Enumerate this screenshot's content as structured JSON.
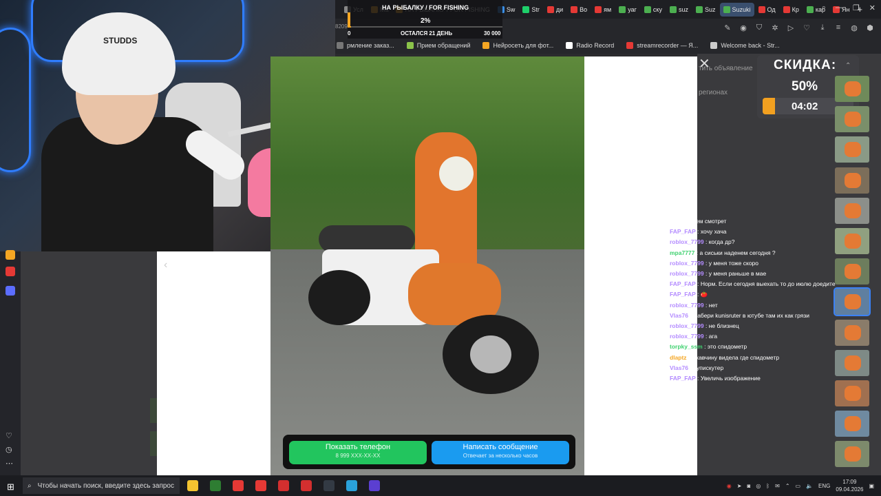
{
  "browser": {
    "tabs": [
      {
        "label": "Усл",
        "color": "#888888"
      },
      {
        "label": "Ма",
        "color": "#f5a623"
      },
      {
        "label": "НА РЫБАЛКУ / FOR FISHING",
        "color": "#f5a623"
      },
      {
        "label": "Sw",
        "color": "#3a8ee6"
      },
      {
        "label": "Str",
        "color": "#1ecf6a"
      },
      {
        "label": "ди",
        "color": "#e53935"
      },
      {
        "label": "Во",
        "color": "#e53935"
      },
      {
        "label": "ям",
        "color": "#e53935"
      },
      {
        "label": "уаг",
        "color": "#4caf50"
      },
      {
        "label": "ску",
        "color": "#4caf50"
      },
      {
        "label": "suz",
        "color": "#4caf50"
      },
      {
        "label": "Suz",
        "color": "#4caf50"
      },
      {
        "label": "Suzuki",
        "color": "#4caf50",
        "active": true
      },
      {
        "label": "Од",
        "color": "#e53935"
      },
      {
        "label": "Кр",
        "color": "#e53935"
      },
      {
        "label": "кар",
        "color": "#4caf50"
      },
      {
        "label": "Ян",
        "color": "#e53935"
      }
    ],
    "new_tab_icon": "plus-icon",
    "bookmarks": [
      {
        "label": "рмление заказ...",
        "color": "#777777"
      },
      {
        "label": "Прием обращений",
        "color": "#8bc34a"
      },
      {
        "label": "Нейросеть для фот...",
        "color": "#f5a623"
      },
      {
        "label": "Radio Record",
        "color": "#ffffff"
      },
      {
        "label": "streamrecorder — Я...",
        "color": "#e53935"
      },
      {
        "label": "Welcome back - Str...",
        "color": "#cccccc"
      }
    ],
    "side_text": "8209..."
  },
  "overlay": {
    "title": "НА РЫБАЛКУ / FOR FISHING",
    "percent_label": "2%",
    "progress": 0.02,
    "start": "0",
    "middle": "ОСТАЛСЯ 21 ДЕНЬ",
    "end": "30 000"
  },
  "page_behind": {
    "text1": "тить объявление",
    "text2": "регионах"
  },
  "viewer": {
    "phone_button": {
      "label": "Показать телефон",
      "sub": "8 999 XXX-XX-XX",
      "color": "#22c55e"
    },
    "message_button": {
      "label": "Написать сообщение",
      "sub": "Отвечает за несколько часов",
      "color": "#1a9bf0"
    }
  },
  "chat": [
    {
      "user": "",
      "text": "будет будем смотрет",
      "color": "#b48cff"
    },
    {
      "user": "FAP_FAP",
      "text": ": хочу хача",
      "color": "#b48cff"
    },
    {
      "user": "roblox_7799",
      "text": ": когда др?",
      "color": "#b48cff"
    },
    {
      "user": "mpa7777",
      "text": ": а сиськи наденем сегодня ?",
      "color": "#3fd16f"
    },
    {
      "user": "roblox_7799",
      "text": ": у меня тоже скоро",
      "color": "#b48cff"
    },
    {
      "user": "roblox_7799",
      "text": ": у меня раньше в мае",
      "color": "#b48cff"
    },
    {
      "user": "FAP_FAP",
      "text": ": Норм. Если сегодня выехать то до июлю доедите",
      "color": "#b48cff"
    },
    {
      "user": "FAP_FAP",
      "text": ": 🍅",
      "color": "#b48cff"
    },
    {
      "user": "roblox_7799",
      "text": ": нет",
      "color": "#b48cff"
    },
    {
      "user": "Vlas76",
      "text": ": Набери kunisruter в ютубе там их как грязи",
      "color": "#b48cff"
    },
    {
      "user": "roblox_7799",
      "text": ": не близнец",
      "color": "#b48cff"
    },
    {
      "user": "roblox_7799",
      "text": ": ага",
      "color": "#b48cff"
    },
    {
      "user": "torpky_ssm",
      "text": ": это спидометр",
      "color": "#3fd16f"
    },
    {
      "user": "dlaptz",
      "text": ": ржавчину видела где спидометр",
      "color": "#f5a623"
    },
    {
      "user": "Vlas76",
      "text": ": Купискутер",
      "color": "#b48cff"
    },
    {
      "user": "FAP_FAP",
      "text": ": Увеличь изображение",
      "color": "#b48cff"
    }
  ],
  "discount": {
    "label": "СКИДКА:",
    "percent": "50%",
    "timer": "04:02",
    "timer_progress": 0.14
  },
  "thumbnails": {
    "count": 13,
    "selected_index": 7
  },
  "taskbar": {
    "search_placeholder": "Чтобы начать поиск, введите здесь запрос",
    "language": "ENG",
    "time": "17:09",
    "date": "09.04.2026",
    "apps": [
      {
        "name": "file-explorer-icon",
        "color": "#f4c430"
      },
      {
        "name": "store-icon",
        "color": "#2e7d32"
      },
      {
        "name": "yandex-icon",
        "color": "#e53935"
      },
      {
        "name": "yandex-browser-icon",
        "color": "#e53935"
      },
      {
        "name": "opera-icon",
        "color": "#d32f2f"
      },
      {
        "name": "opera-gx-icon",
        "color": "#d32f2f"
      },
      {
        "name": "steam-icon",
        "color": "#333a44"
      },
      {
        "name": "telegram-icon",
        "color": "#2aa1da"
      },
      {
        "name": "vk-icon",
        "color": "#5b3fd1"
      }
    ]
  }
}
